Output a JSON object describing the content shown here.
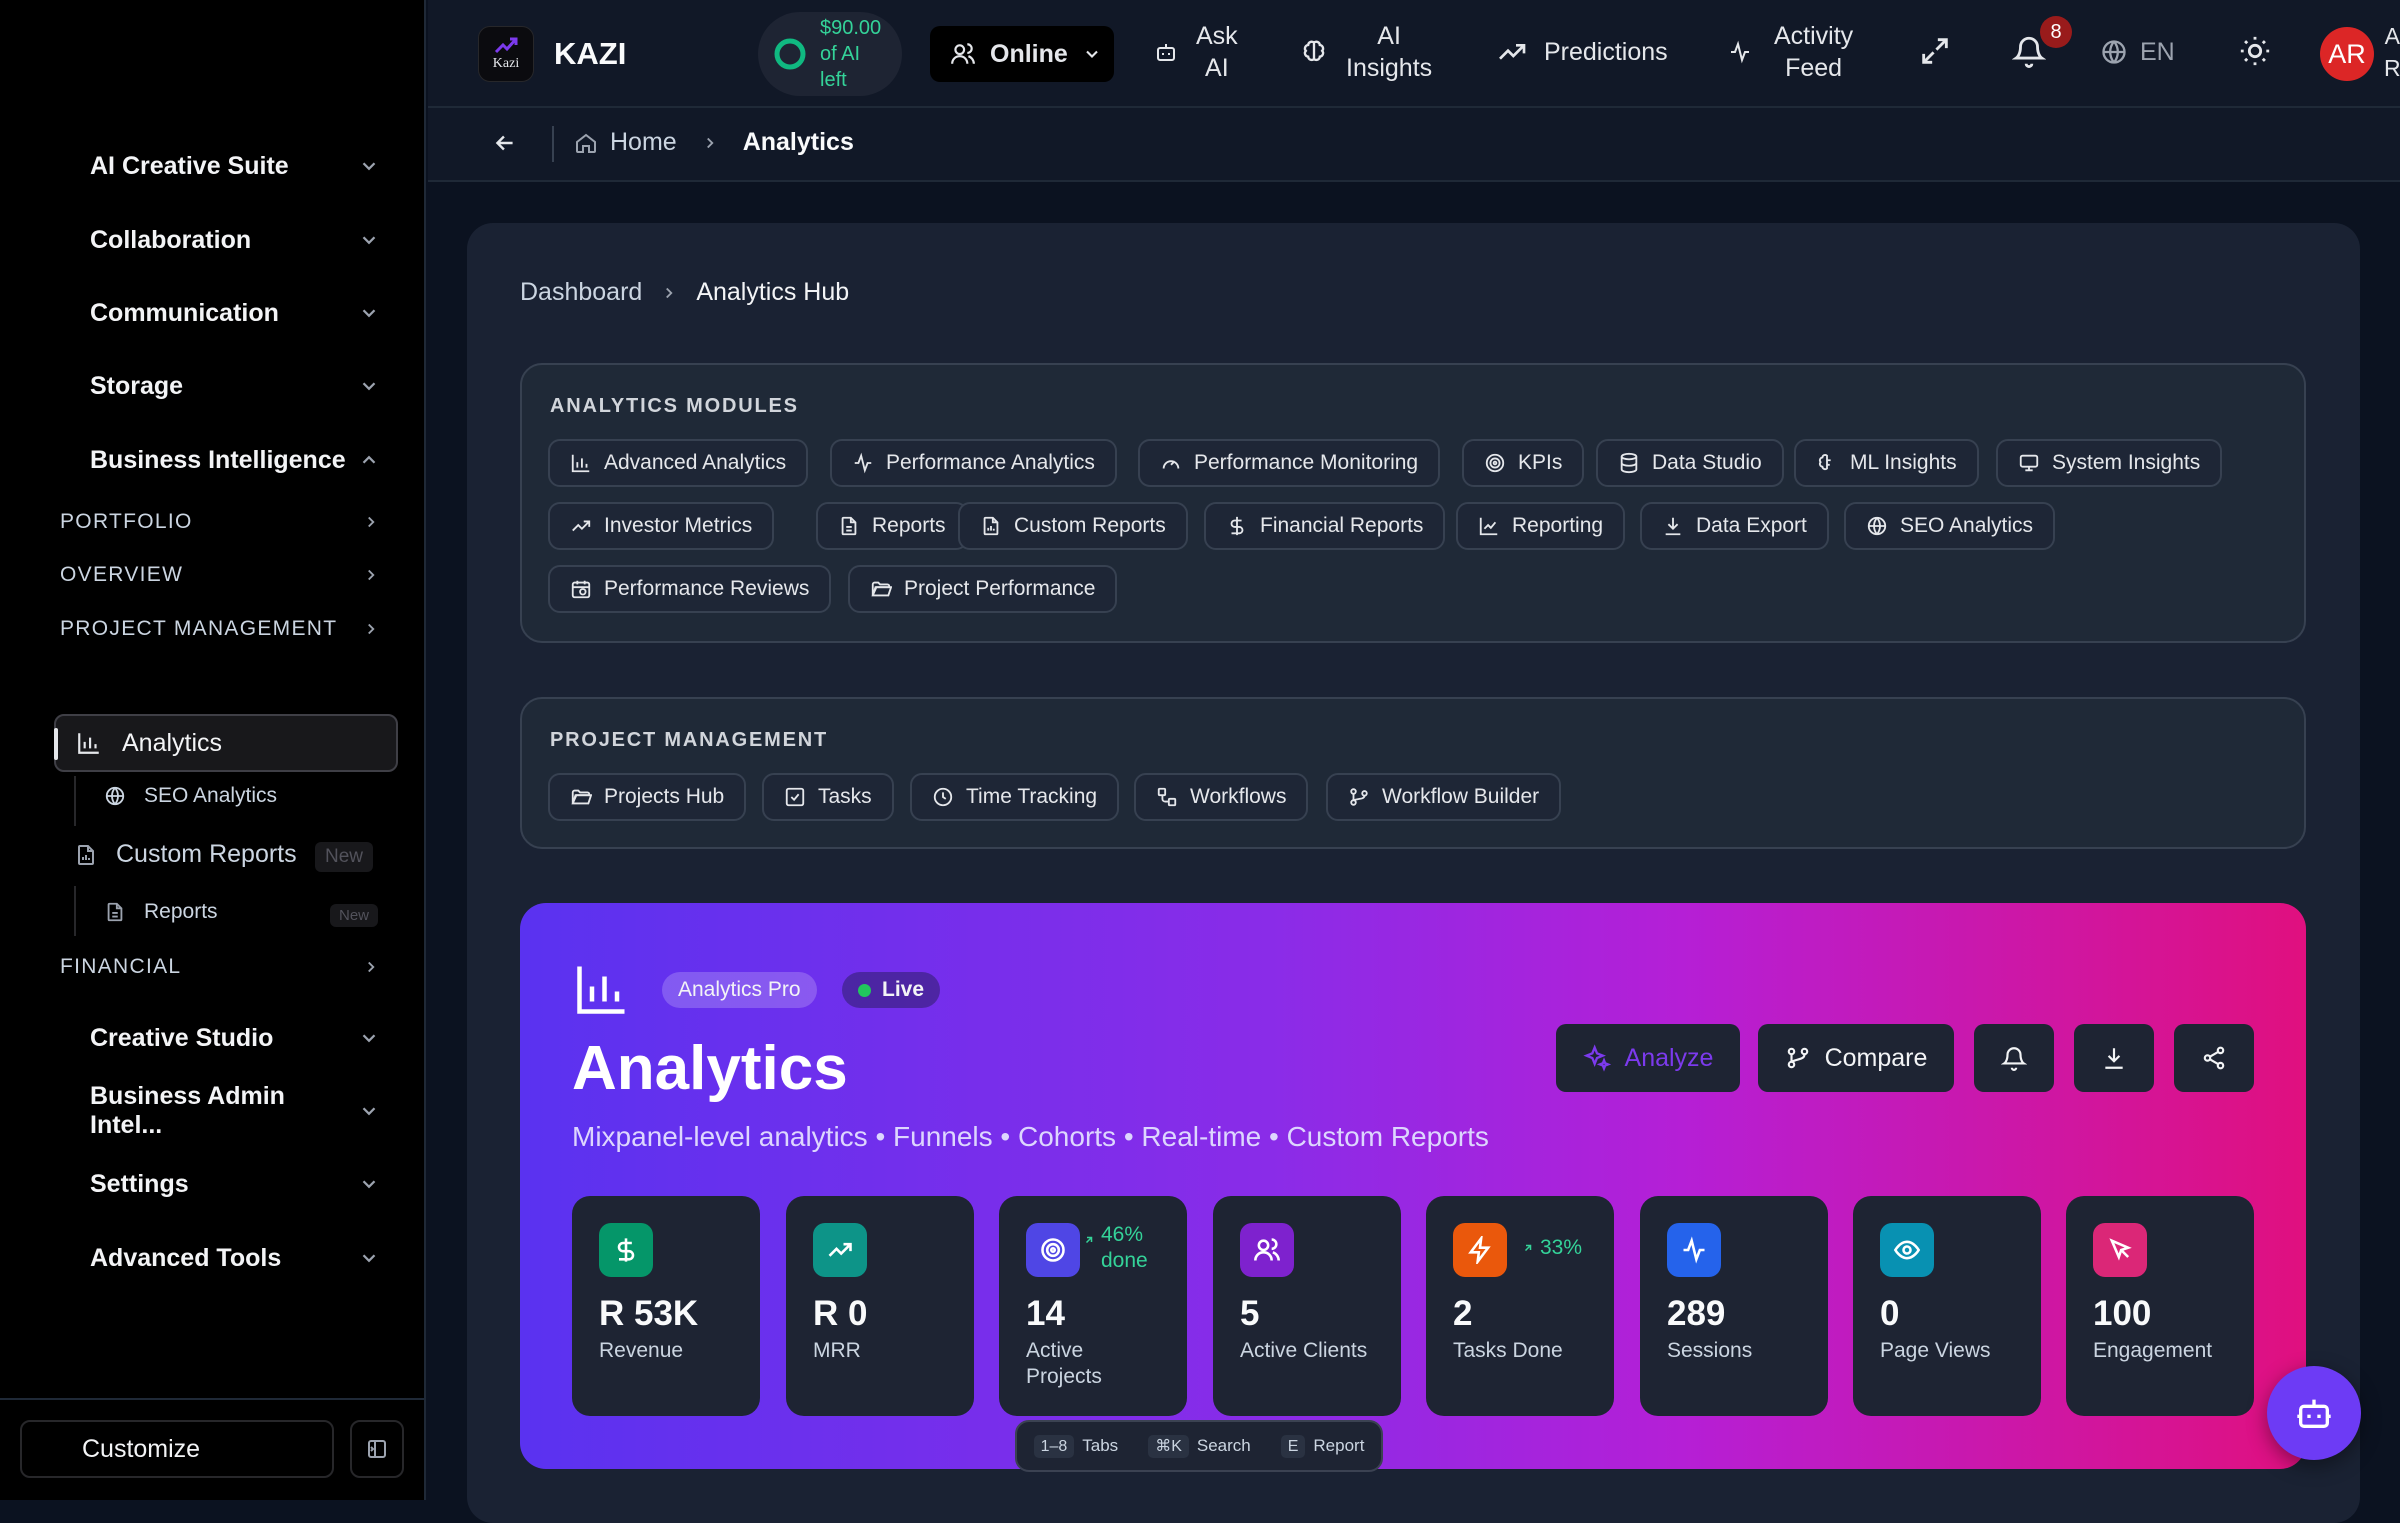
{
  "app": {
    "name": "KAZI",
    "logo_text": "Kazi"
  },
  "topbar": {
    "ai_credit": "$90.00 of AI left",
    "ai_credit_lines": [
      "$90.00",
      "of AI",
      "left"
    ],
    "status": "Online",
    "ask_ai": [
      "Ask",
      "AI"
    ],
    "ai_insights": [
      "AI",
      "Insights"
    ],
    "predictions": "Predictions",
    "activity_feed": [
      "Activity",
      "Feed"
    ],
    "notifications_count": "8",
    "language": "EN",
    "avatar_initials": "AR",
    "user_name_partial": [
      "A",
      "R"
    ]
  },
  "breadcrumb_top": {
    "home": "Home",
    "current": "Analytics"
  },
  "sidebar": {
    "groups": [
      {
        "label": "AI Creative Suite"
      },
      {
        "label": "Collaboration"
      },
      {
        "label": "Communication"
      },
      {
        "label": "Storage"
      },
      {
        "label": "Business Intelligence"
      }
    ],
    "subsections": [
      "PORTFOLIO",
      "OVERVIEW",
      "PROJECT MANAGEMENT"
    ],
    "active_item": "Analytics",
    "child_seo": "SEO Analytics",
    "custom_reports": "Custom Reports",
    "custom_reports_badge": "New",
    "reports": "Reports",
    "reports_badge": "New",
    "financial": "FINANCIAL",
    "lower_groups": [
      "Creative Studio",
      "Business Admin Intel...",
      "Settings",
      "Advanced Tools"
    ],
    "customize": "Customize"
  },
  "page_breadcrumb": {
    "root": "Dashboard",
    "current": "Analytics Hub"
  },
  "analytics_modules": {
    "title": "ANALYTICS MODULES",
    "items": [
      "Advanced Analytics",
      "Performance Analytics",
      "Performance Monitoring",
      "KPIs",
      "Data Studio",
      "ML Insights",
      "System Insights",
      "Investor Metrics",
      "Reports",
      "Custom Reports",
      "Financial Reports",
      "Reporting",
      "Data Export",
      "SEO Analytics",
      "Performance Reviews",
      "Project Performance"
    ]
  },
  "project_management": {
    "title": "PROJECT MANAGEMENT",
    "items": [
      "Projects Hub",
      "Tasks",
      "Time Tracking",
      "Workflows",
      "Workflow Builder"
    ]
  },
  "hero": {
    "badge": "Analytics Pro",
    "live": "Live",
    "title": "Analytics",
    "subtitle": "Mixpanel-level analytics • Funnels • Cohorts • Real-time • Custom Reports",
    "buttons": {
      "analyze": "Analyze",
      "compare": "Compare"
    }
  },
  "stats": [
    {
      "value": "R 53K",
      "label": "Revenue",
      "color": "#059669"
    },
    {
      "value": "R 0",
      "label": "MRR",
      "color": "#0d9488"
    },
    {
      "value": "14",
      "label": "Active Projects",
      "label_lines": [
        "Active",
        "Projects"
      ],
      "trend": "46% done",
      "trend_lines": [
        "46%",
        "done"
      ],
      "color": "#4f46e5"
    },
    {
      "value": "5",
      "label": "Active Clients",
      "color": "#7e22ce"
    },
    {
      "value": "2",
      "label": "Tasks Done",
      "trend": "33%",
      "color": "#ea580c"
    },
    {
      "value": "289",
      "label": "Sessions",
      "color": "#2563eb"
    },
    {
      "value": "0",
      "label": "Page Views",
      "color": "#0891b2"
    },
    {
      "value": "100",
      "label": "Engagement",
      "color": "#db2777"
    }
  ],
  "shortcuts": [
    {
      "key": "1–8",
      "label": "Tabs"
    },
    {
      "key": "⌘K",
      "label": "Search"
    },
    {
      "key": "E",
      "label": "Report"
    }
  ]
}
